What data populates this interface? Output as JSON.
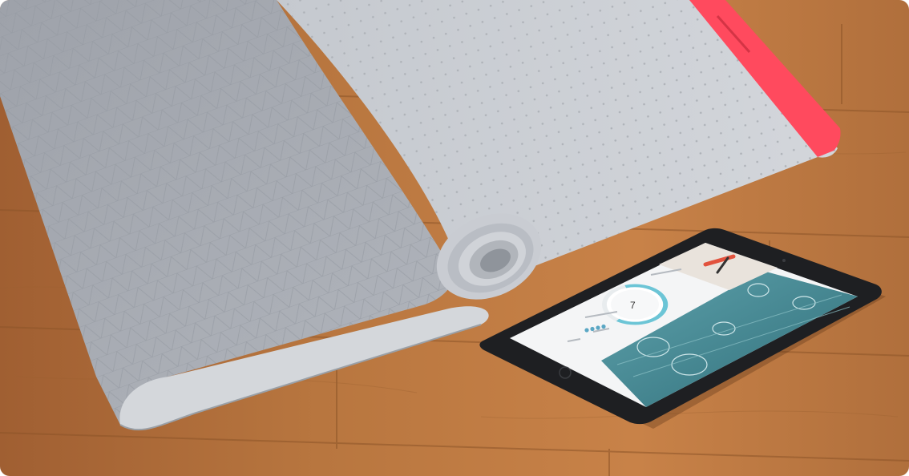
{
  "scene": {
    "floor_color": "#b06c3b",
    "mat_color": "#a9adb5",
    "mat_light_color": "#c8ccd2",
    "accent_color": "#ff4a5e"
  },
  "tablet": {
    "screen": {
      "header_title": "",
      "counter_value": "7",
      "stat_label_1": "",
      "stat_label_2": "",
      "stat_label_3": "",
      "panel_color": "#4a8f9a"
    }
  }
}
